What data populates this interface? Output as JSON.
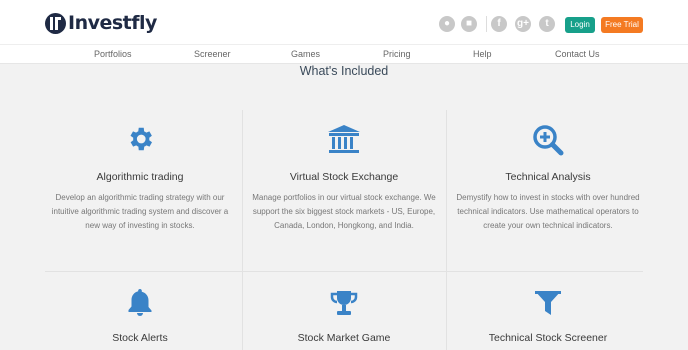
{
  "brand": {
    "logo_text": "Investfly",
    "accent": "#3a83c7"
  },
  "header": {
    "social_icons": [
      "apple-icon",
      "android-icon",
      "facebook-icon",
      "google-plus-icon",
      "twitter-icon"
    ],
    "login_label": "Login",
    "trial_label": "Free Trial"
  },
  "nav": {
    "items": [
      "Portfolios",
      "Screener",
      "Games",
      "Pricing",
      "Help",
      "Contact Us"
    ]
  },
  "main": {
    "title": "What's Included",
    "features": [
      {
        "icon": "gear-icon",
        "title": "Algorithmic trading",
        "desc": "Develop an algorithmic trading strategy with our intuitive algorithmic trading system and discover a new way of investing in stocks."
      },
      {
        "icon": "bank-icon",
        "title": "Virtual Stock Exchange",
        "desc": "Manage portfolios in our virtual stock exchange. We support the six biggest stock markets - US, Europe, Canada, London, Hongkong, and India."
      },
      {
        "icon": "zoom-in-icon",
        "title": "Technical Analysis",
        "desc": "Demystify how to invest in stocks with over hundred technical indicators. Use mathematical operators to create your own technical indicators."
      },
      {
        "icon": "bell-icon",
        "title": "Stock Alerts",
        "desc": ""
      },
      {
        "icon": "trophy-icon",
        "title": "Stock Market Game",
        "desc": ""
      },
      {
        "icon": "filter-icon",
        "title": "Technical Stock Screener",
        "desc": ""
      }
    ]
  }
}
